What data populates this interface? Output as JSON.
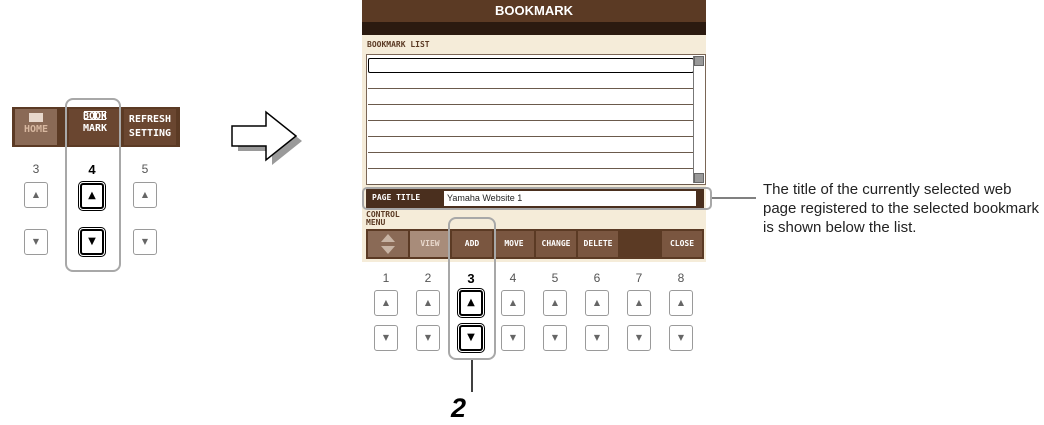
{
  "panel_left": {
    "buttons": [
      {
        "line1": "",
        "line2": "HOME",
        "icon": "house-icon",
        "enabled": false
      },
      {
        "line1": "BOOK",
        "line2": "MARK",
        "icon": "book-icon",
        "enabled": true
      },
      {
        "line1": "REFRESH",
        "line2": "SETTING",
        "icon": "",
        "enabled": true
      }
    ],
    "numbers": [
      "3",
      "4",
      "5"
    ],
    "up_glyph": "▲",
    "down_glyph": "▼"
  },
  "window": {
    "title": "BOOKMARK",
    "list_label": "BOOKMARK LIST",
    "list_rows": [
      "",
      "",
      "",
      "",
      "",
      "",
      "",
      ""
    ],
    "page_title_label": "PAGE TITLE",
    "page_title_value": "Yamaha Website 1",
    "control_menu_label_1": "CONTROL",
    "control_menu_label_2": "MENU",
    "buttons": [
      {
        "label": "",
        "enabled": false
      },
      {
        "label": "VIEW",
        "enabled": false
      },
      {
        "label": "ADD",
        "enabled": true
      },
      {
        "label": "MOVE",
        "enabled": true
      },
      {
        "label": "CHANGE",
        "enabled": true
      },
      {
        "label": "DELETE",
        "enabled": true
      },
      {
        "label": "",
        "enabled": false
      },
      {
        "label": "CLOSE",
        "enabled": true
      }
    ],
    "numbers": [
      "1",
      "2",
      "3",
      "4",
      "5",
      "6",
      "7",
      "8"
    ]
  },
  "callout": {
    "text": "The title of the currently selected web page registered to the selected bookmark is shown below the list."
  },
  "step_label": "2",
  "colors": {
    "brand_brown": "#5b3a24",
    "panel_bg": "#f5ecd9",
    "highlight_gray": "#a8a8a8"
  }
}
